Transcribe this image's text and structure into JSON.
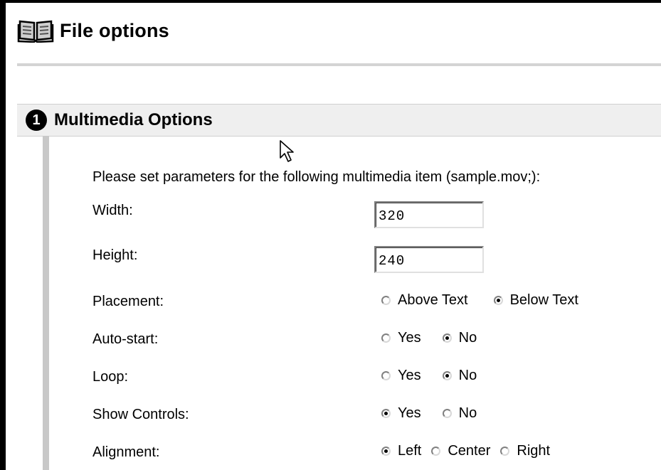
{
  "page": {
    "title": "File options",
    "icon": "book-icon"
  },
  "section": {
    "step": "1",
    "title": "Multimedia Options"
  },
  "intro": "Please set parameters for the following multimedia item (sample.mov;):",
  "fields": {
    "width": {
      "label": "Width:",
      "value": "320"
    },
    "height": {
      "label": "Height:",
      "value": "240"
    }
  },
  "radios": {
    "placement": {
      "label": "Placement:",
      "options": [
        "Above Text",
        "Below Text"
      ],
      "selected": "Below Text"
    },
    "autostart": {
      "label": "Auto-start:",
      "options": [
        "Yes",
        "No"
      ],
      "selected": "No"
    },
    "loop": {
      "label": "Loop:",
      "options": [
        "Yes",
        "No"
      ],
      "selected": "No"
    },
    "controls": {
      "label": "Show Controls:",
      "options": [
        "Yes",
        "No"
      ],
      "selected": "Yes"
    },
    "alignment": {
      "label": "Alignment:",
      "options": [
        "Left",
        "Center",
        "Right"
      ],
      "selected": "Left"
    }
  },
  "colors": {
    "section_bar": "#efefef",
    "rule": "#d4d4d4",
    "left_bar": "#c8c8c8"
  }
}
